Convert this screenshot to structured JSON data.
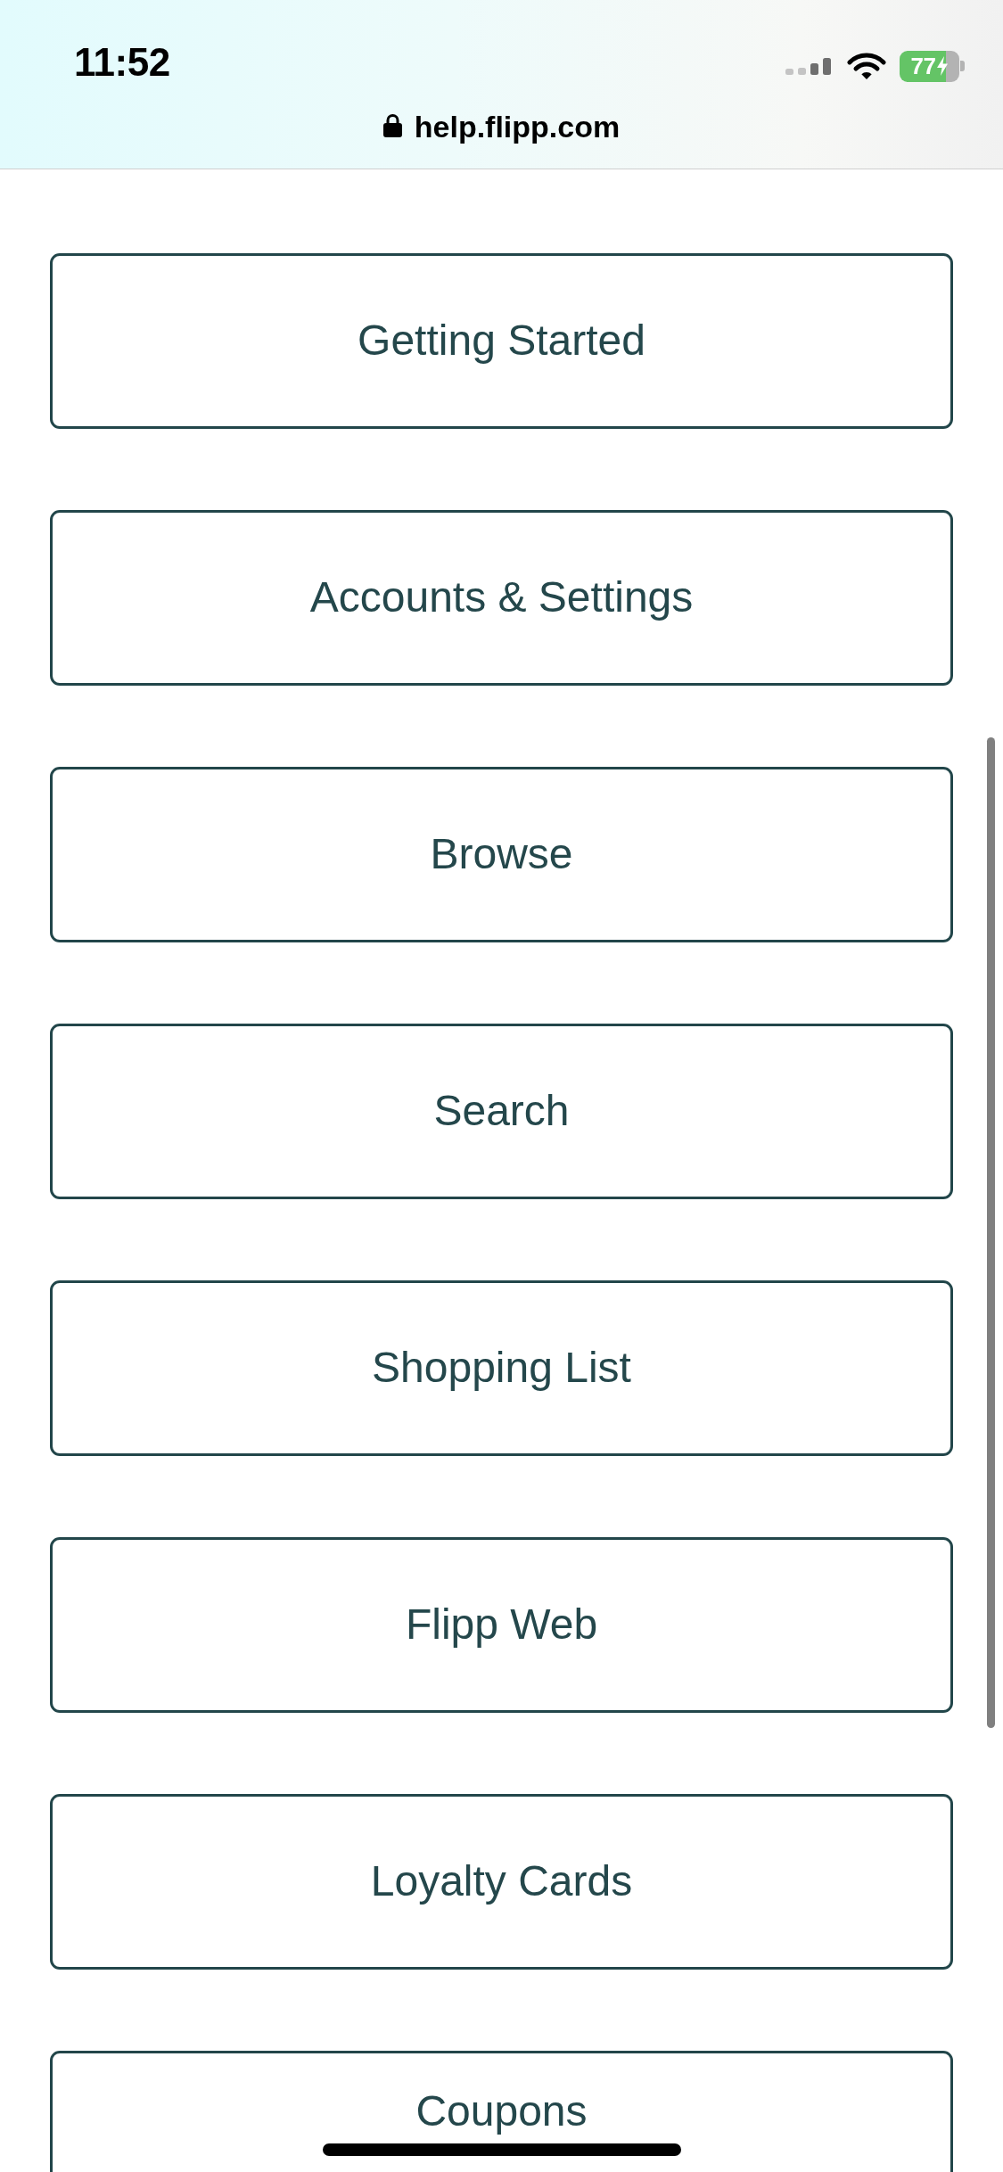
{
  "status_bar": {
    "time": "11:52",
    "battery_percentage": "77",
    "charging": true
  },
  "address_bar": {
    "url": "help.flipp.com",
    "secure": true
  },
  "categories": [
    "Getting Started",
    "Accounts & Settings",
    "Browse",
    "Search",
    "Shopping List",
    "Flipp Web",
    "Loyalty Cards",
    "Coupons"
  ]
}
